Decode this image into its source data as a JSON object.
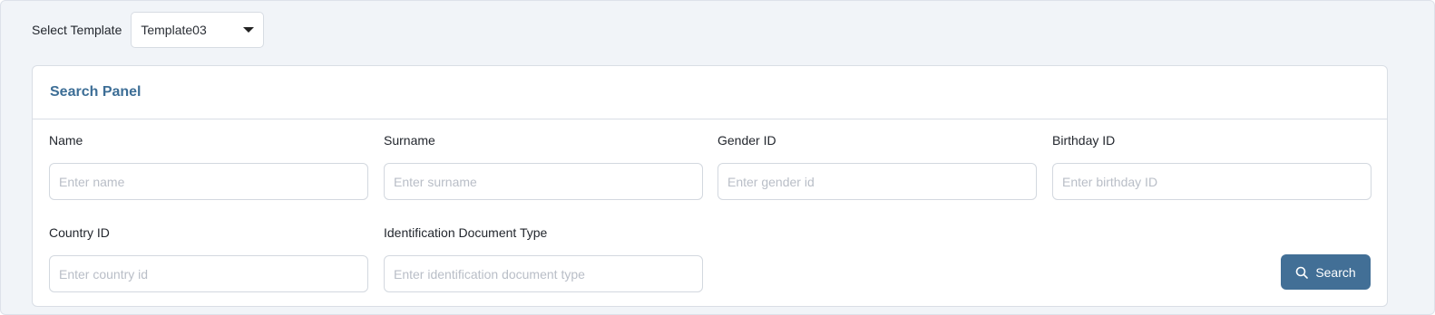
{
  "template": {
    "label": "Select Template",
    "selected": "Template03"
  },
  "panel": {
    "title": "Search Panel",
    "fields": [
      {
        "label": "Name",
        "placeholder": "Enter name"
      },
      {
        "label": "Surname",
        "placeholder": "Enter surname"
      },
      {
        "label": "Gender ID",
        "placeholder": "Enter gender id"
      },
      {
        "label": "Birthday ID",
        "placeholder": "Enter birthday ID"
      },
      {
        "label": "Country ID",
        "placeholder": "Enter country id"
      },
      {
        "label": "Identification Document Type",
        "placeholder": "Enter identification document type"
      }
    ],
    "search_label": "Search"
  },
  "colors": {
    "accent": "#426f96",
    "panel_title": "#3d6e96",
    "background": "#f1f4f8"
  },
  "icons": {
    "dropdown": "caret-down-icon",
    "search": "search-icon"
  }
}
